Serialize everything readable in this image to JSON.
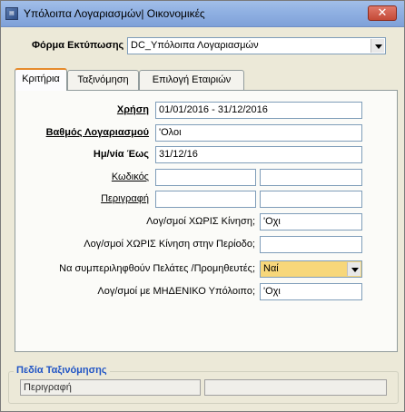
{
  "window": {
    "title": "Υπόλοιπα Λογαριασμών| Οικονομικές",
    "close_glyph": "✕",
    "icon": "app-icon"
  },
  "print_form": {
    "label": "Φόρμα Εκτύπωσης",
    "value": "DC_Υπόλοιπα Λογαριασμών"
  },
  "tabs": [
    {
      "label": "Κριτήρια",
      "active": true
    },
    {
      "label": "Ταξινόμηση",
      "active": false
    },
    {
      "label": "Επιλογή Εταιριών",
      "active": false
    }
  ],
  "criteria": {
    "fiscal_year": {
      "label": "Χρήση",
      "value": "01/01/2016 - 31/12/2016"
    },
    "account_level": {
      "label": "Βαθμός Λογαριασμού",
      "value": "'Ολοι"
    },
    "date_to": {
      "label": "Ημ/νία Έως",
      "value": "31/12/16"
    },
    "code": {
      "label": "Κωδικός",
      "from": "",
      "to": ""
    },
    "description": {
      "label": "Περιγραφή",
      "from": "",
      "to": ""
    },
    "no_movement": {
      "label": "Λογ/σμοί ΧΩΡΙΣ Κίνηση;",
      "value": "'Οχι"
    },
    "no_movement_period": {
      "label": "Λογ/σμοί ΧΩΡΙΣ Κίνηση στην Περίοδο;",
      "value": ""
    },
    "include_customers": {
      "label": "Να συμπεριληφθούν Πελάτες /Προμηθευτές;",
      "value": "Ναί"
    },
    "zero_balance": {
      "label": "Λογ/σμοί με ΜΗΔΕΝΙΚΟ Υπόλοιπο;",
      "value": "'Οχι"
    }
  },
  "sort_fields": {
    "label": "Πεδία Ταξινόμησης",
    "field1": "Περιγραφή",
    "field2": ""
  },
  "colors": {
    "titlebar": "#8fb0e2",
    "highlight": "#f7d77a",
    "group_label": "#2155c5"
  }
}
